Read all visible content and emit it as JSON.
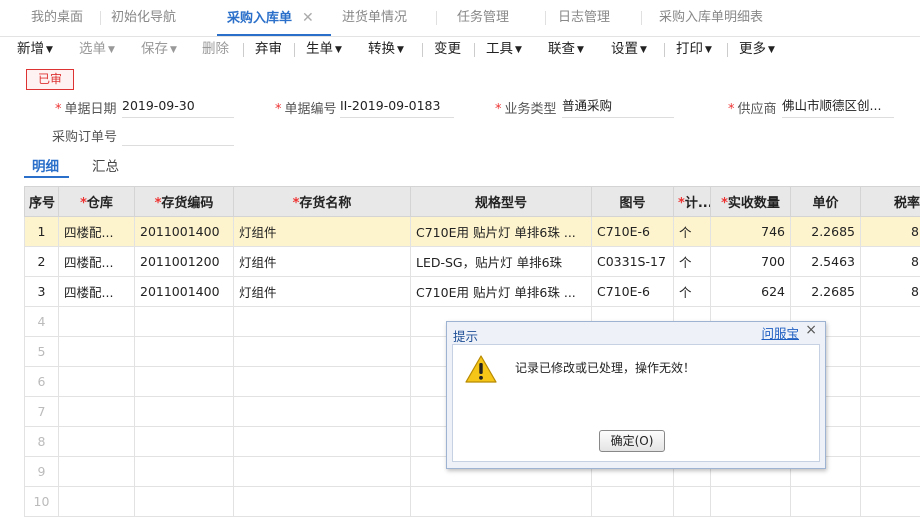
{
  "tabs": [
    {
      "label": "我的桌面"
    },
    {
      "label": "初始化导航"
    },
    {
      "label": "采购入库单"
    },
    {
      "label": "进货单情况"
    },
    {
      "label": "任务管理"
    },
    {
      "label": "日志管理"
    },
    {
      "label": "采购入库单明细表"
    }
  ],
  "toolbar": {
    "add": "新增",
    "select": "选单",
    "save": "保存",
    "delete": "删除",
    "abandon": "弃审",
    "generate": "生单",
    "convert": "转换",
    "change": "变更",
    "tools": "工具",
    "linked": "联查",
    "settings": "设置",
    "print": "打印",
    "more": "更多"
  },
  "header": {
    "status": "已审",
    "date_label": "单据日期",
    "date_value": "2019-09-30",
    "code_label": "单据编号",
    "code_value": "II-2019-09-0183",
    "biztype_label": "业务类型",
    "biztype_value": "普通采购",
    "supplier_label": "供应商",
    "supplier_value": "佛山市顺德区创...",
    "po_label": "采购订单号",
    "po_value": ""
  },
  "subtabs": {
    "detail": "明细",
    "summary": "汇总"
  },
  "grid": {
    "headers": {
      "seq": "序号",
      "warehouse": "仓库",
      "code": "存货编码",
      "name": "存货名称",
      "spec": "规格型号",
      "drawing": "图号",
      "unit": "计...",
      "qty": "实收数量",
      "price": "单价",
      "tax": "税率"
    },
    "rows": [
      {
        "seq": "1",
        "warehouse": "四楼配...",
        "code": "2011001400",
        "name": "灯组件",
        "spec": "C710E用 贴片灯 单排6珠 ...",
        "drawing": "C710E-6",
        "unit": "个",
        "qty": "746",
        "price": "2.2685",
        "tax": "8"
      },
      {
        "seq": "2",
        "warehouse": "四楼配...",
        "code": "2011001200",
        "name": "灯组件",
        "spec": "LED-SG，贴片灯 单排6珠",
        "drawing": "C0331S-17",
        "unit": "个",
        "qty": "700",
        "price": "2.5463",
        "tax": "8"
      },
      {
        "seq": "3",
        "warehouse": "四楼配...",
        "code": "2011001400",
        "name": "灯组件",
        "spec": "C710E用 贴片灯 单排6珠 ...",
        "drawing": "C710E-6",
        "unit": "个",
        "qty": "624",
        "price": "2.2685",
        "tax": "8"
      }
    ],
    "empty_rows": [
      "4",
      "5",
      "6",
      "7",
      "8",
      "9",
      "10"
    ]
  },
  "dialog": {
    "title": "提示",
    "help": "问服宝",
    "close": "×",
    "message": "记录已修改或已处理，操作无效！",
    "ok": "确定(O)",
    "icon": "warning-icon"
  }
}
